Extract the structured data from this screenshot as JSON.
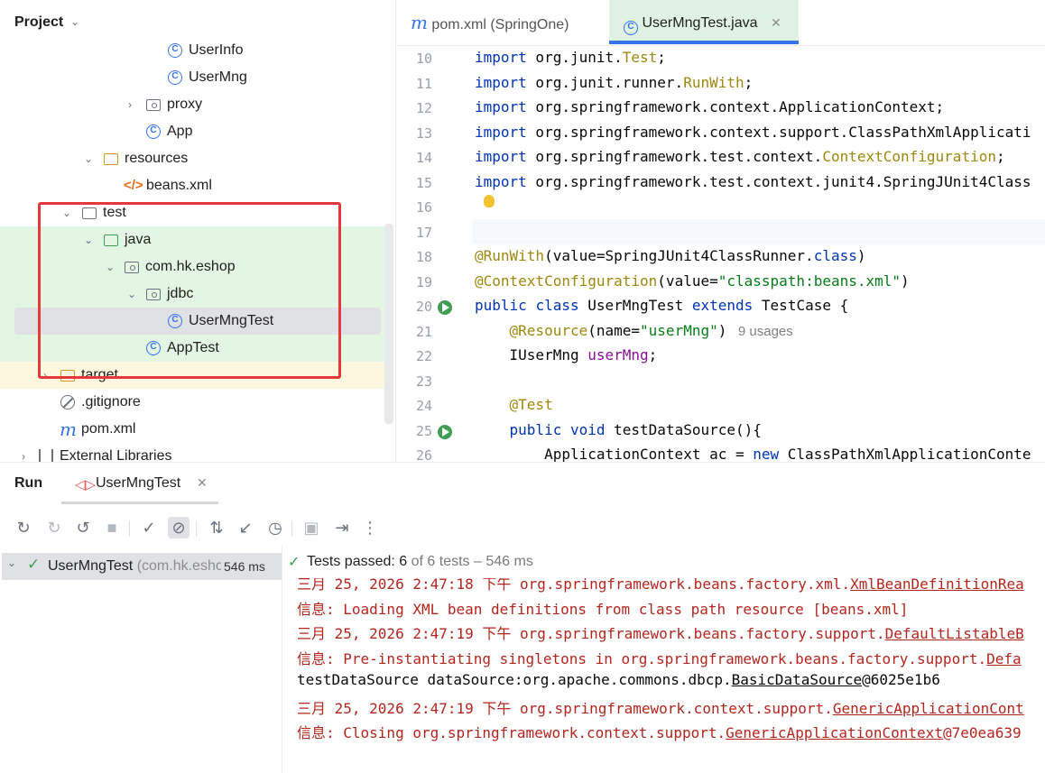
{
  "project": {
    "title": "Project",
    "tree": [
      {
        "label": "UserInfo",
        "icon": "class-icon"
      },
      {
        "label": "UserMng",
        "icon": "class-icon"
      },
      {
        "label": "proxy",
        "icon": "package-icon"
      },
      {
        "label": "App",
        "icon": "runnable-class-icon"
      },
      {
        "label": "resources",
        "icon": "resources-folder-icon"
      },
      {
        "label": "beans.xml",
        "icon": "xml-icon"
      },
      {
        "label": "test",
        "icon": "folder-icon"
      },
      {
        "label": "java",
        "icon": "test-folder-icon"
      },
      {
        "label": "com.hk.eshop",
        "icon": "package-icon"
      },
      {
        "label": "jdbc",
        "icon": "package-icon"
      },
      {
        "label": "UserMngTest",
        "icon": "test-class-icon"
      },
      {
        "label": "AppTest",
        "icon": "test-class-icon"
      },
      {
        "label": "target",
        "icon": "folder-icon"
      },
      {
        "label": ".gitignore",
        "icon": "ignore-icon"
      },
      {
        "label": "pom.xml",
        "icon": "maven-icon"
      },
      {
        "label": "External Libraries",
        "icon": "library-icon"
      }
    ]
  },
  "editor": {
    "tabs": [
      {
        "label": "pom.xml (SpringOne)",
        "icon": "maven-icon"
      },
      {
        "label": "UserMngTest.java",
        "icon": "test-class-icon"
      }
    ],
    "hint": "9 usages",
    "lines": [
      {
        "n": "10",
        "text": "import org.junit.Test;"
      },
      {
        "n": "11",
        "text": "import org.junit.runner.RunWith;"
      },
      {
        "n": "12",
        "text": "import org.springframework.context.ApplicationContext;"
      },
      {
        "n": "13",
        "text": "import org.springframework.context.support.ClassPathXmlApplicati"
      },
      {
        "n": "14",
        "text": "import org.springframework.test.context.ContextConfiguration;"
      },
      {
        "n": "15",
        "text": "import org.springframework.test.context.junit4.SpringJUnit4Class"
      },
      {
        "n": "16",
        "text": ""
      },
      {
        "n": "17",
        "text": ""
      },
      {
        "n": "18",
        "text": "@RunWith(value=SpringJUnit4ClassRunner.class)"
      },
      {
        "n": "19",
        "text": "@ContextConfiguration(value=\"classpath:beans.xml\")"
      },
      {
        "n": "20",
        "text": "public class UserMngTest extends TestCase {"
      },
      {
        "n": "21",
        "text": "    @Resource(name=\"userMng\")"
      },
      {
        "n": "22",
        "text": "    IUserMng userMng;"
      },
      {
        "n": "23",
        "text": ""
      },
      {
        "n": "24",
        "text": "    @Test"
      },
      {
        "n": "25",
        "text": "    public void testDataSource(){"
      },
      {
        "n": "26",
        "text": "        ApplicationContext ac = new ClassPathXmlApplicationConte"
      }
    ]
  },
  "run": {
    "title": "Run",
    "tab_label": "UserMngTest",
    "tree_item": {
      "name": "UserMngTest",
      "package": "(com.hk.eshop",
      "time": "546 ms"
    },
    "status": {
      "prefix": "Tests passed: ",
      "count": "6",
      "suffix": " of 6 tests – 546 ms"
    },
    "console": [
      {
        "kind": "err",
        "text": "三月 25, 2026 2:47:18 下午 org.springframework.beans.factory.xml.XmlBeanDefinitionRea"
      },
      {
        "kind": "err",
        "text": "信息: Loading XML bean definitions from class path resource [beans.xml]"
      },
      {
        "kind": "err",
        "text": "三月 25, 2026 2:47:19 下午 org.springframework.beans.factory.support.DefaultListableB"
      },
      {
        "kind": "err",
        "text": "信息: Pre-instantiating singletons in org.springframework.beans.factory.support.Defa"
      },
      {
        "kind": "out",
        "text": "testDataSource dataSource:org.apache.commons.dbcp.BasicDataSource@6025e1b6"
      },
      {
        "kind": "err",
        "text": "三月 25, 2026 2:47:19 下午 org.springframework.context.support.GenericApplicationCont"
      },
      {
        "kind": "err",
        "text": "信息: Closing org.springframework.context.support.GenericApplicationContext@7e0ea639"
      }
    ]
  },
  "colors": {
    "accent": "#3574f0",
    "pass": "#3f9e53",
    "error_text": "#b3261e",
    "highlight_box": "#e5383b"
  }
}
